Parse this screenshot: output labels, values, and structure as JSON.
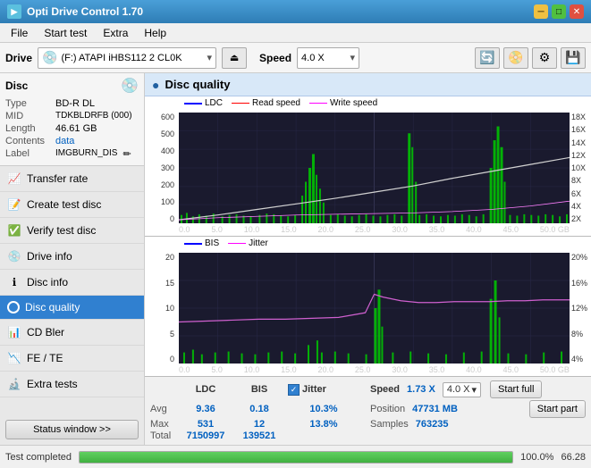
{
  "titlebar": {
    "title": "Opti Drive Control 1.70",
    "min_label": "─",
    "max_label": "□",
    "close_label": "✕"
  },
  "menu": {
    "items": [
      "File",
      "Start test",
      "Extra",
      "Help"
    ]
  },
  "drive_bar": {
    "drive_label": "Drive",
    "drive_value": "(F:)  ATAPI iHBS112  2 CL0K",
    "speed_label": "Speed",
    "speed_value": "4.0 X"
  },
  "disc": {
    "title": "Disc",
    "type_label": "Type",
    "type_value": "BD-R DL",
    "mid_label": "MID",
    "mid_value": "TDKBLDRFB (000)",
    "length_label": "Length",
    "length_value": "46.61 GB",
    "contents_label": "Contents",
    "contents_value": "data",
    "label_label": "Label",
    "label_value": "IMGBURN_DIS"
  },
  "nav": {
    "items": [
      {
        "id": "transfer-rate",
        "label": "Transfer rate",
        "active": false
      },
      {
        "id": "create-test-disc",
        "label": "Create test disc",
        "active": false
      },
      {
        "id": "verify-test-disc",
        "label": "Verify test disc",
        "active": false
      },
      {
        "id": "drive-info",
        "label": "Drive info",
        "active": false
      },
      {
        "id": "disc-info",
        "label": "Disc info",
        "active": false
      },
      {
        "id": "disc-quality",
        "label": "Disc quality",
        "active": true
      },
      {
        "id": "cd-bler",
        "label": "CD Bler",
        "active": false
      },
      {
        "id": "fe-te",
        "label": "FE / TE",
        "active": false
      },
      {
        "id": "extra-tests",
        "label": "Extra tests",
        "active": false
      }
    ],
    "status_btn": "Status window >>"
  },
  "quality": {
    "header": "Disc quality",
    "chart1": {
      "legend": [
        "LDC",
        "Read speed",
        "Write speed"
      ],
      "y_left": [
        "600",
        "500",
        "400",
        "300",
        "200",
        "100",
        "0"
      ],
      "y_right": [
        "18X",
        "16X",
        "14X",
        "12X",
        "10X",
        "8X",
        "6X",
        "4X",
        "2X"
      ],
      "x_axis": [
        "0.0",
        "5.0",
        "10.0",
        "15.0",
        "20.0",
        "25.0",
        "30.0",
        "35.0",
        "40.0",
        "45.0",
        "50.0 GB"
      ]
    },
    "chart2": {
      "legend": [
        "BIS",
        "Jitter"
      ],
      "y_left": [
        "20",
        "15",
        "10",
        "5",
        "0"
      ],
      "y_right": [
        "20%",
        "16%",
        "12%",
        "8%",
        "4%"
      ],
      "x_axis": [
        "0.0",
        "5.0",
        "10.0",
        "15.0",
        "20.0",
        "25.0",
        "30.0",
        "35.0",
        "40.0",
        "45.0",
        "50.0 GB"
      ]
    }
  },
  "stats": {
    "col_ldc": "LDC",
    "col_bis": "BIS",
    "jitter_label": "Jitter",
    "speed_label": "Speed",
    "speed_value": "1.73 X",
    "speed_select": "4.0 X",
    "avg_label": "Avg",
    "avg_ldc": "9.36",
    "avg_bis": "0.18",
    "avg_jitter": "10.3%",
    "max_label": "Max",
    "max_ldc": "531",
    "max_bis": "12",
    "max_jitter": "13.8%",
    "position_label": "Position",
    "position_value": "47731 MB",
    "total_label": "Total",
    "total_ldc": "7150997",
    "total_bis": "139521",
    "samples_label": "Samples",
    "samples_value": "763235",
    "start_full": "Start full",
    "start_part": "Start part"
  },
  "statusbar": {
    "text": "Test completed",
    "progress": 100,
    "pct_text": "100.0%",
    "right_value": "66.28"
  }
}
